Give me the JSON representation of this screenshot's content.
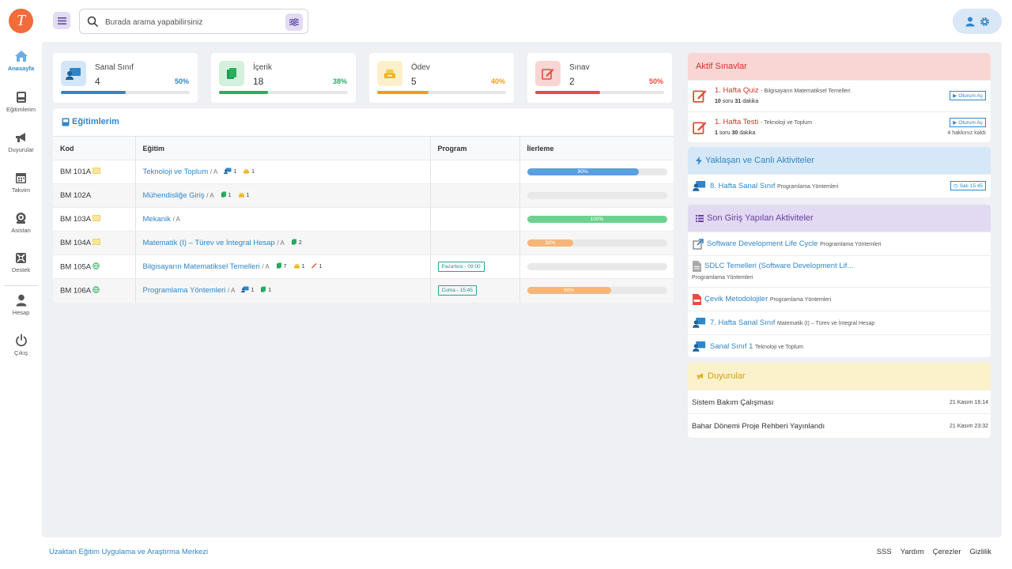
{
  "sidebar": {
    "logo_letter": "T",
    "items": [
      {
        "label": "Anasayfa",
        "icon": "home-icon"
      },
      {
        "label": "Eğitimlerim",
        "icon": "book-icon"
      },
      {
        "label": "Duyurular",
        "icon": "megaphone-icon"
      },
      {
        "label": "Takvim",
        "icon": "calendar-icon"
      },
      {
        "label": "Asistan",
        "icon": "robot-icon"
      },
      {
        "label": "Destek",
        "icon": "support-icon"
      },
      {
        "label": "Hesap",
        "icon": "user-icon"
      },
      {
        "label": "Çıkış",
        "icon": "power-icon"
      }
    ]
  },
  "search": {
    "placeholder": "Burada arama yapabilirsiniz",
    "value": ""
  },
  "stats": [
    {
      "name": "Sanal Sınıf",
      "count": "4",
      "percent": "50%",
      "fraction": 0.5,
      "color": "#2f86c9",
      "icon_bg": "#d3e6f7",
      "icon": "virtual-class-icon"
    },
    {
      "name": "İçerik",
      "count": "18",
      "percent": "38%",
      "fraction": 0.38,
      "color": "#27ae60",
      "icon_bg": "#d2f0dc",
      "icon": "content-icon"
    },
    {
      "name": "Ödev",
      "count": "5",
      "percent": "40%",
      "fraction": 0.4,
      "color": "#f39c12",
      "icon_bg": "#fdefc9",
      "icon": "homework-icon"
    },
    {
      "name": "Sınav",
      "count": "2",
      "percent": "50%",
      "fraction": 0.5,
      "color": "#e74c3c",
      "icon_bg": "#f9d6d3",
      "icon": "exam-icon"
    }
  ],
  "education": {
    "title": "Eğitimlerim",
    "headers": [
      "Kod",
      "Eğitim",
      "Program",
      "İlerleme"
    ],
    "rows": [
      {
        "code": "BM 101A",
        "badge": "folder",
        "name": "Teknoloji ve Toplum",
        "section": "/ A",
        "counts": [
          [
            "class",
            "1"
          ],
          [
            "homework",
            "1"
          ]
        ],
        "program": "",
        "progress": 0.8,
        "progress_label": "80%",
        "progress_color": "#5a9fe0"
      },
      {
        "code": "BM 102A",
        "badge": "",
        "name": "Mühendisliğe Giriş",
        "section": "/ A",
        "counts": [
          [
            "content",
            "1"
          ],
          [
            "homework",
            "1"
          ]
        ],
        "program": "",
        "progress": 0,
        "progress_label": "",
        "progress_color": "#5a9fe0"
      },
      {
        "code": "BM 103A",
        "badge": "folder",
        "name": "Mekanik",
        "section": "/ A",
        "counts": [],
        "program": "",
        "progress": 1.0,
        "progress_label": "100%",
        "progress_color": "#6fd18f"
      },
      {
        "code": "BM 104A",
        "badge": "folder",
        "name": "Matematik (I) – Türev ve İntegral Hesap",
        "section": "/ A",
        "counts": [
          [
            "content",
            "2"
          ]
        ],
        "program": "",
        "progress": 0.33,
        "progress_label": "33%",
        "progress_color": "#f5b67a"
      },
      {
        "code": "BM 105A",
        "badge": "globe",
        "name": "Bilgisayarın Matematiksel Temelleri",
        "section": "/ A",
        "counts": [
          [
            "content",
            "7"
          ],
          [
            "homework",
            "1"
          ],
          [
            "exam",
            "1"
          ]
        ],
        "program": "Pazartesi - 09:00",
        "progress": 0,
        "progress_label": "",
        "progress_color": "#5a9fe0"
      },
      {
        "code": "BM 106A",
        "badge": "globe",
        "name": "Programlama Yöntemleri",
        "section": "/ A",
        "counts": [
          [
            "class",
            "1"
          ],
          [
            "content",
            "1"
          ]
        ],
        "program": "Cuma - 15:45",
        "progress": 0.6,
        "progress_label": "60%",
        "progress_color": "#f5b67a"
      }
    ]
  },
  "active_exams": {
    "title": "Aktif Sınavlar",
    "items": [
      {
        "title": "1. Hafta Quiz",
        "course": "- Bilgisayarın Matematiksel Temelleri",
        "q_count": "10",
        "q_label": "soru",
        "minutes": "31",
        "m_label": "dakika",
        "button": "Oturum Aç",
        "note": ""
      },
      {
        "title": "1. Hafta Testi",
        "course": "- Teknoloji ve Toplum",
        "q_count": "1",
        "q_label": "soru",
        "minutes": "30",
        "m_label": "dakika",
        "button": "Oturum Aç",
        "note": "4 hakkınız kaldı"
      }
    ]
  },
  "upcoming": {
    "title": "Yaklaşan ve Canlı Aktiviteler",
    "items": [
      {
        "title": "8. Hafta Sanal Sınıf",
        "course": "Programlama Yöntemleri",
        "time": "Salı 15:45"
      }
    ]
  },
  "recent": {
    "title": "Son Giriş Yapılan Aktiviteler",
    "items": [
      {
        "icon": "external-link-icon",
        "title": "Software Development Life Cycle",
        "course": "Programlama Yöntemleri",
        "wrap": false
      },
      {
        "icon": "document-icon",
        "title": "SDLC Temelleri (Software Development Lif...",
        "course": "Programlama Yöntemleri",
        "wrap": true
      },
      {
        "icon": "pdf-icon",
        "title": "Çevik Metodolojiler",
        "course": "Programlama Yöntemleri",
        "wrap": false
      },
      {
        "icon": "virtual-class-icon",
        "title": "7. Hafta Sanal Sınıf",
        "course": "Matematik (I) – Türev ve İntegral Hesap",
        "wrap": false
      },
      {
        "icon": "virtual-class-icon",
        "title": "Sanal Sınıf 1",
        "course": "Teknoloji ve Toplum",
        "wrap": false
      }
    ]
  },
  "announcements": {
    "title": "Duyurular",
    "items": [
      {
        "title": "Sistem Bakım Çalışması",
        "date": "21 Kasım 16:14"
      },
      {
        "title": "Bahar Dönemi Proje Rehberi Yayınlandı",
        "date": "21 Kasım 23:32"
      }
    ]
  },
  "footer": {
    "org": "Uzaktan Eğitim Uygulama ve Araştırma Merkezi",
    "links": [
      "SSS",
      "Yardım",
      "Çerezler",
      "Gizlilik"
    ]
  },
  "colors": {
    "accent": "#2f86c9",
    "exams_head": "#f9d6d3",
    "upcoming_head": "#d6e8f7",
    "recent_head": "#e2d9f2",
    "announce_head": "#fbf2cb"
  }
}
